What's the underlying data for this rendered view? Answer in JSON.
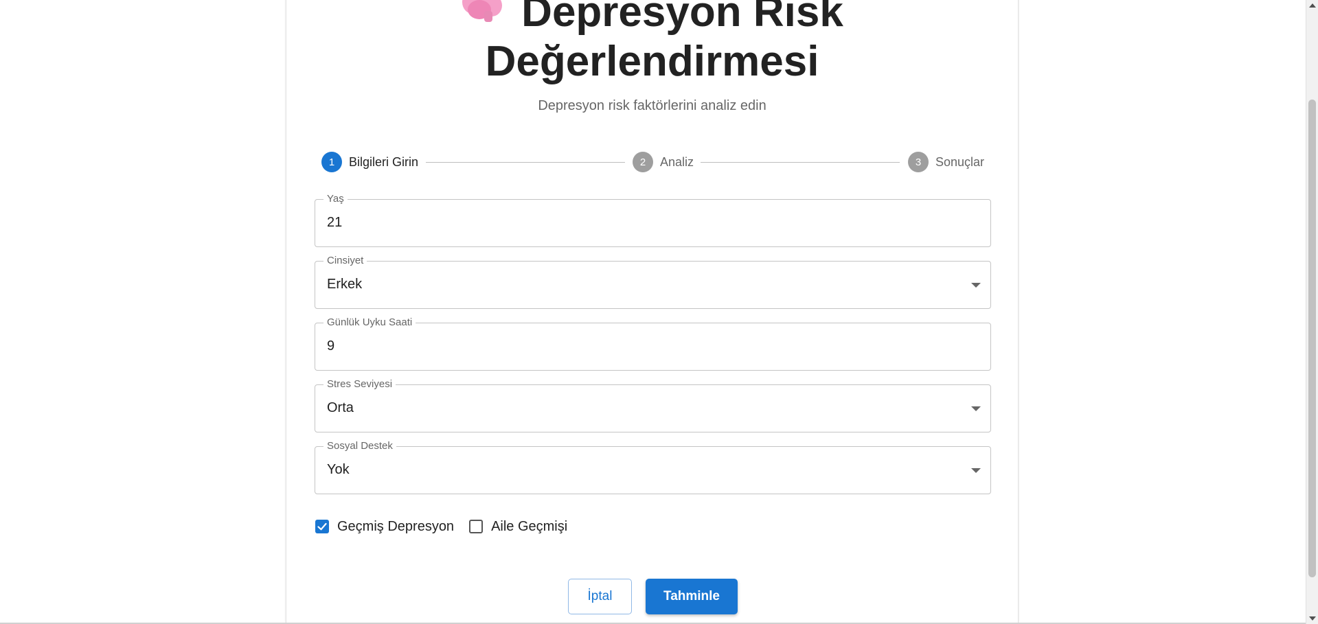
{
  "header": {
    "icon": "brain-icon",
    "title_line1": "Depresyon Risk",
    "title_line2": "Değerlendirmesi",
    "subtitle": "Depresyon risk faktörlerini analiz edin"
  },
  "stepper": {
    "steps": [
      {
        "number": "1",
        "label": "Bilgileri Girin",
        "state": "active"
      },
      {
        "number": "2",
        "label": "Analiz",
        "state": "inactive"
      },
      {
        "number": "3",
        "label": "Sonuçlar",
        "state": "inactive"
      }
    ]
  },
  "form": {
    "age": {
      "label": "Yaş",
      "value": "21"
    },
    "gender": {
      "label": "Cinsiyet",
      "value": "Erkek"
    },
    "sleep": {
      "label": "Günlük Uyku Saati",
      "value": "9"
    },
    "stress": {
      "label": "Stres Seviyesi",
      "value": "Orta"
    },
    "social": {
      "label": "Sosyal Destek",
      "value": "Yok"
    },
    "past_depression": {
      "label": "Geçmiş Depresyon",
      "checked": true
    },
    "family_history": {
      "label": "Aile Geçmişi",
      "checked": false
    }
  },
  "actions": {
    "cancel_label": "İptal",
    "submit_label": "Tahminle"
  },
  "colors": {
    "primary": "#1976d2",
    "step_inactive": "#9e9e9e",
    "icon_pink": "#f5a0c8"
  }
}
